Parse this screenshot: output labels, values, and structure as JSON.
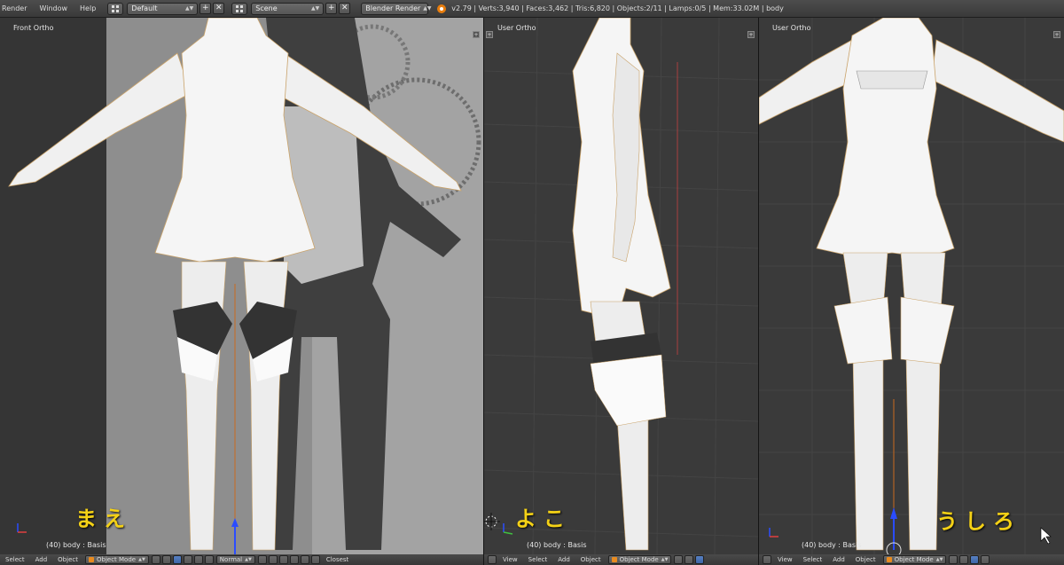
{
  "topbar": {
    "menus": [
      "Render",
      "Window",
      "Help"
    ],
    "layout": "Default",
    "scene": "Scene",
    "engine": "Blender Render",
    "stats": "v2.79 | Verts:3,940 | Faces:3,462 | Tris:6,820 | Objects:2/11 | Lamps:0/5 | Mem:33.02M | body",
    "add_glyph": "+",
    "close_glyph": "✕"
  },
  "viewports": {
    "front": {
      "title": "Front Ortho",
      "info": "(40) body : Basis",
      "caption": "まえ"
    },
    "side": {
      "title": "User Ortho",
      "info": "(40) body : Basis",
      "caption": "よこ"
    },
    "back": {
      "title": "User Ortho",
      "info": "(40) body : Basis",
      "caption": "うしろ"
    }
  },
  "headers": {
    "front": {
      "items": [
        "Select",
        "Add",
        "Object"
      ],
      "mode": "Object Mode",
      "shading": "Normal",
      "snap": "Closest"
    },
    "side": {
      "items": [
        "View",
        "Select",
        "Add",
        "Object"
      ],
      "mode": "Object Mode"
    },
    "back": {
      "items": [
        "View",
        "Select",
        "Add",
        "Object"
      ],
      "mode": "Object Mode"
    }
  },
  "colors": {
    "caption": "#f4d116",
    "viewport_bg": "#3a3a3a",
    "header_bg": "#3a3a3a",
    "mode_icon": "#e98b1f",
    "z_axis": "#2a4cff",
    "x_axis": "#e04040",
    "y_axis": "#40c040",
    "grid_line": "#444444"
  }
}
